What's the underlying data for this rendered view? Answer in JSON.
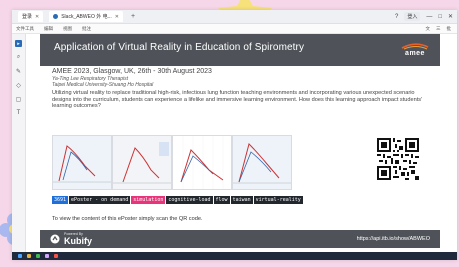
{
  "browser": {
    "tabs": [
      {
        "label": "登录"
      },
      {
        "label": "Slack_ABWEO 外 电..."
      }
    ],
    "new_tab": "+",
    "login_label": "登入",
    "menu_items": [
      "文件工具",
      "编辑",
      "视图",
      "批注"
    ],
    "menu_right": [
      "文",
      "三",
      "批"
    ]
  },
  "poster": {
    "title": "Application of Virtual Reality in Education of Spirometry",
    "conference": "AMEE 2023, Glasgow, UK, 26th - 30th August 2023",
    "author_line1": "Ya-Ting Lee Respiratory Therapist",
    "author_line2": "Taipei Medical University-Shuang Ho Hospital",
    "abstract": "Utilizing virtual reality to replace traditional high-risk, infectious lung function teaching environments and incorporating various unexpected scenario designs into the curriculum, students can experience a lifelike and immersive learning environment. How does this learning approach impact students' learning outcomes?",
    "tags": [
      "3691",
      "ePoster - on demand",
      "simulation",
      "cognitive-load",
      "flow",
      "taiwan",
      "virtual-reality"
    ],
    "scan_text": "To view the content of this ePoster simply scan the QR code.",
    "logo_text": "amee"
  },
  "footer": {
    "powered_by": "Powered By",
    "brand": "Kubify",
    "url": "https://api.itb.io/show/ABWEO"
  },
  "colors": {
    "header_bg": "#4f5359",
    "tag_blue": "#1e6fd9",
    "tag_pink": "#e8347a",
    "tag_dark": "#22272e",
    "background": "#f6d7e9"
  },
  "icons": [
    "select-icon",
    "zoom-icon",
    "pen-icon",
    "eraser-icon",
    "shape-icon",
    "text-icon"
  ]
}
